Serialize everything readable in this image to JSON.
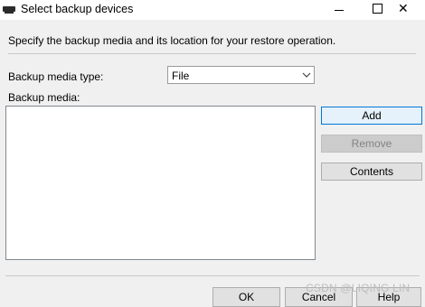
{
  "window": {
    "title": "Select backup devices",
    "controls": [
      "minimize-icon",
      "maximize-icon",
      "close-icon"
    ],
    "close_glyph": "✕"
  },
  "instruction": "Specify the backup media and its location for your restore operation.",
  "media_type": {
    "label": "Backup media type:",
    "selected": "File"
  },
  "backup_media": {
    "label": "Backup media:",
    "items": []
  },
  "side_buttons": {
    "add": "Add",
    "remove": "Remove",
    "contents": "Contents"
  },
  "footer": {
    "ok": "OK",
    "cancel": "Cancel",
    "help": "Help"
  },
  "watermark": "CSDN @LIQING LIN",
  "colors": {
    "dialog_bg": "#f0f0f0",
    "focus_border": "#0078d7",
    "disabled_text": "#838383"
  }
}
